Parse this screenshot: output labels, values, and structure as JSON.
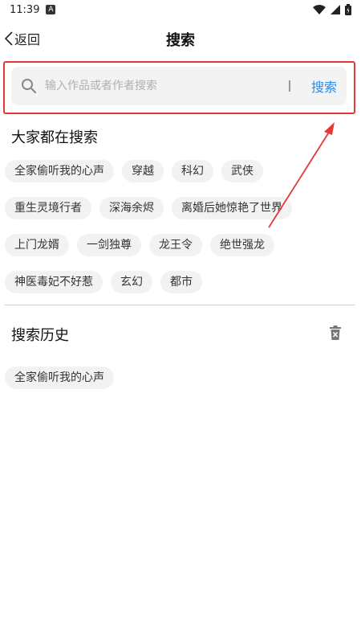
{
  "status_bar": {
    "time": "11:39",
    "a_badge": "A"
  },
  "header": {
    "back_label": "返回",
    "title": "搜索"
  },
  "search": {
    "placeholder": "输入作品或者作者搜索",
    "value": "",
    "button_label": "搜索"
  },
  "popular": {
    "title": "大家都在搜索",
    "rows": [
      [
        "全家偷听我的心声",
        "穿越",
        "科幻",
        "武侠"
      ],
      [
        "重生灵境行者",
        "深海余烬",
        "离婚后她惊艳了世界"
      ],
      [
        "上门龙婿",
        "一剑独尊",
        "龙王令",
        "绝世强龙"
      ],
      [
        "神医毒妃不好惹",
        "玄幻",
        "都市"
      ]
    ]
  },
  "history": {
    "title": "搜索历史",
    "items": [
      "全家偷听我的心声"
    ]
  },
  "colors": {
    "accent": "#2b8be6",
    "highlight": "#e53935",
    "tag_bg": "#f2f2f2"
  }
}
